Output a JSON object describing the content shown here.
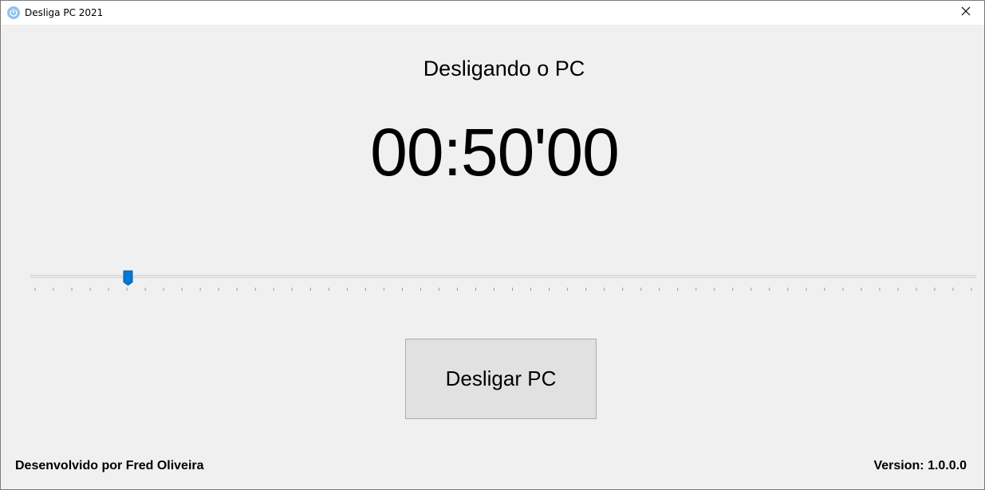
{
  "window": {
    "title": "Desliga PC 2021",
    "app_icon": "power-icon",
    "close_icon": "close-icon"
  },
  "main": {
    "status_label": "Desligando o PC",
    "timer": "00:50'00",
    "slider": {
      "value_fraction": 0.1,
      "tick_count": 52,
      "accent_color": "#0078d7"
    },
    "action_button": "Desligar PC"
  },
  "footer": {
    "developer": "Desenvolvido por Fred Oliveira",
    "version": "Version: 1.0.0.0"
  }
}
